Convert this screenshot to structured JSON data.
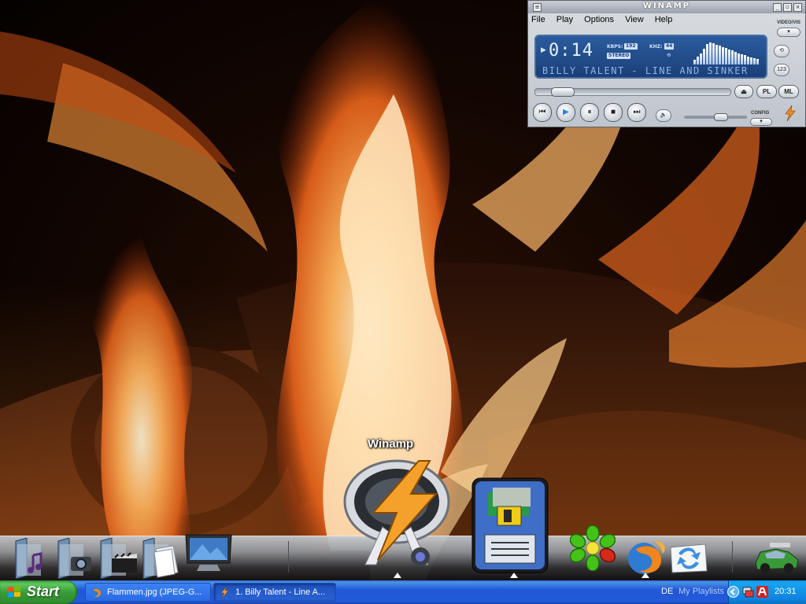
{
  "wallpaper": {
    "subject": "fire-flames-on-logs"
  },
  "winamp": {
    "title": "WINAMP",
    "menu": [
      "File",
      "Play",
      "Options",
      "View",
      "Help"
    ],
    "video_vis_label": "VIDEO/VIS",
    "time": "0:14",
    "kbps_label": "KBPS:",
    "kbps_value": "192",
    "khz_label": "KHZ:",
    "khz_value": "44",
    "stereo_label": "STEREO",
    "song_title": "BILLY TALENT - LINE AND SINKER",
    "pl_label": "PL",
    "ml_label": "ML",
    "config_label": "CONFIG",
    "seek_position": 0.09,
    "volume_level": 0.62
  },
  "dock": {
    "hover_label": "Winamp",
    "items": [
      "music-folder-icon",
      "pictures-folder-icon",
      "videos-folder-icon",
      "documents-folder-icon",
      "my-computer-icon",
      "winamp-icon",
      "save-floppy-icon",
      "icq-icon",
      "firefox-icon",
      "sync-icon",
      "racing-car-icon"
    ]
  },
  "taskbar": {
    "start_label": "Start",
    "tasks": [
      {
        "label": "Flammen.jpg (JPEG-G...",
        "icon": "firefox-icon",
        "active": false
      },
      {
        "label": "1. Billy Talent - Line A...",
        "icon": "winamp-icon",
        "active": true
      }
    ],
    "language": "DE",
    "playlists_label": "My Playlists",
    "clock": "20:31"
  }
}
